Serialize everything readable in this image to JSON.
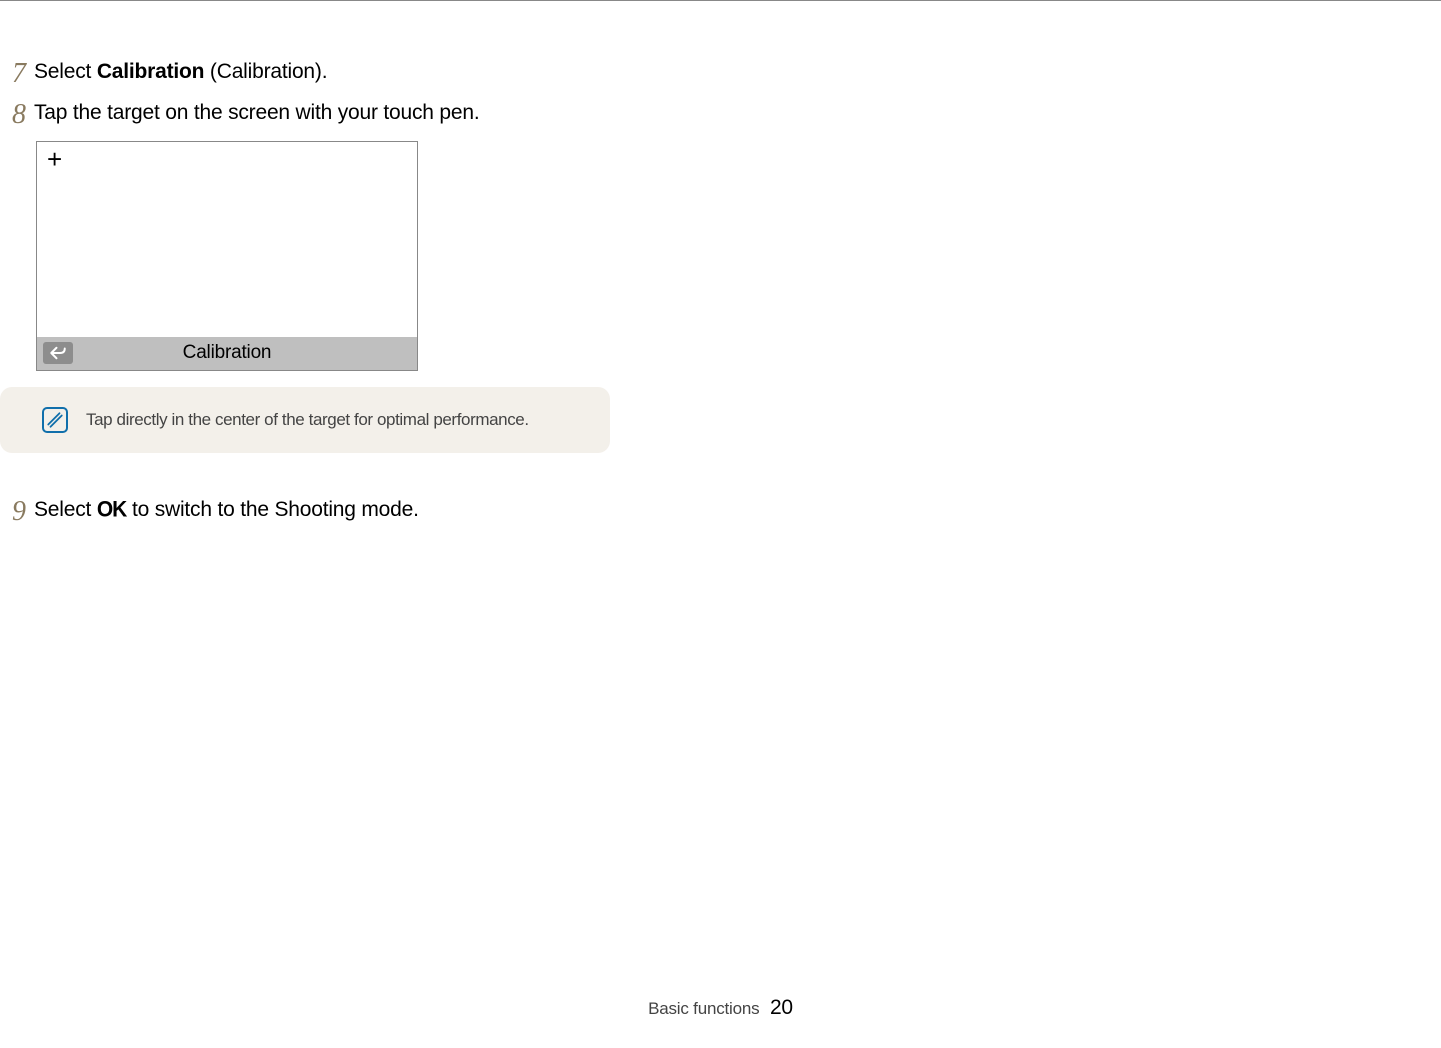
{
  "steps": {
    "s7": {
      "num": "7",
      "pre": "Select ",
      "bold": "Calibration",
      "post": " (Calibration)."
    },
    "s8": {
      "num": "8",
      "text": "Tap the target on the screen with your touch pen."
    },
    "s9": {
      "num": "9",
      "pre": "Select ",
      "ok": "OK",
      "post": " to switch to the Shooting mode."
    }
  },
  "mockup": {
    "target_symbol": "+",
    "title": "Calibration"
  },
  "note": {
    "text": "Tap directly in the center of the target for optimal performance."
  },
  "footer": {
    "section": "Basic functions",
    "page": "20"
  }
}
